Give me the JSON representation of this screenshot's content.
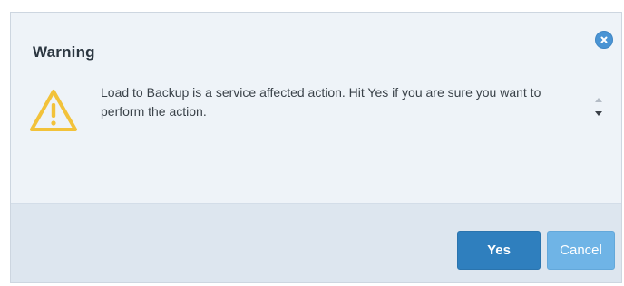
{
  "dialog": {
    "title": "Warning",
    "message": "Load to Backup is a service affected action. Hit Yes if you are sure you want to perform the action.",
    "close_icon": "close-icon",
    "warning_icon": "warning-triangle-icon",
    "scroll_up_icon": "scroll-up-arrow-icon",
    "scroll_down_icon": "scroll-down-arrow-icon"
  },
  "buttons": {
    "yes_label": "Yes",
    "cancel_label": "Cancel"
  },
  "colors": {
    "primary_button": "#2f7fbe",
    "secondary_button": "#6fb4e6",
    "close_button": "#4a94d4",
    "warning_icon": "#f2c23a"
  }
}
